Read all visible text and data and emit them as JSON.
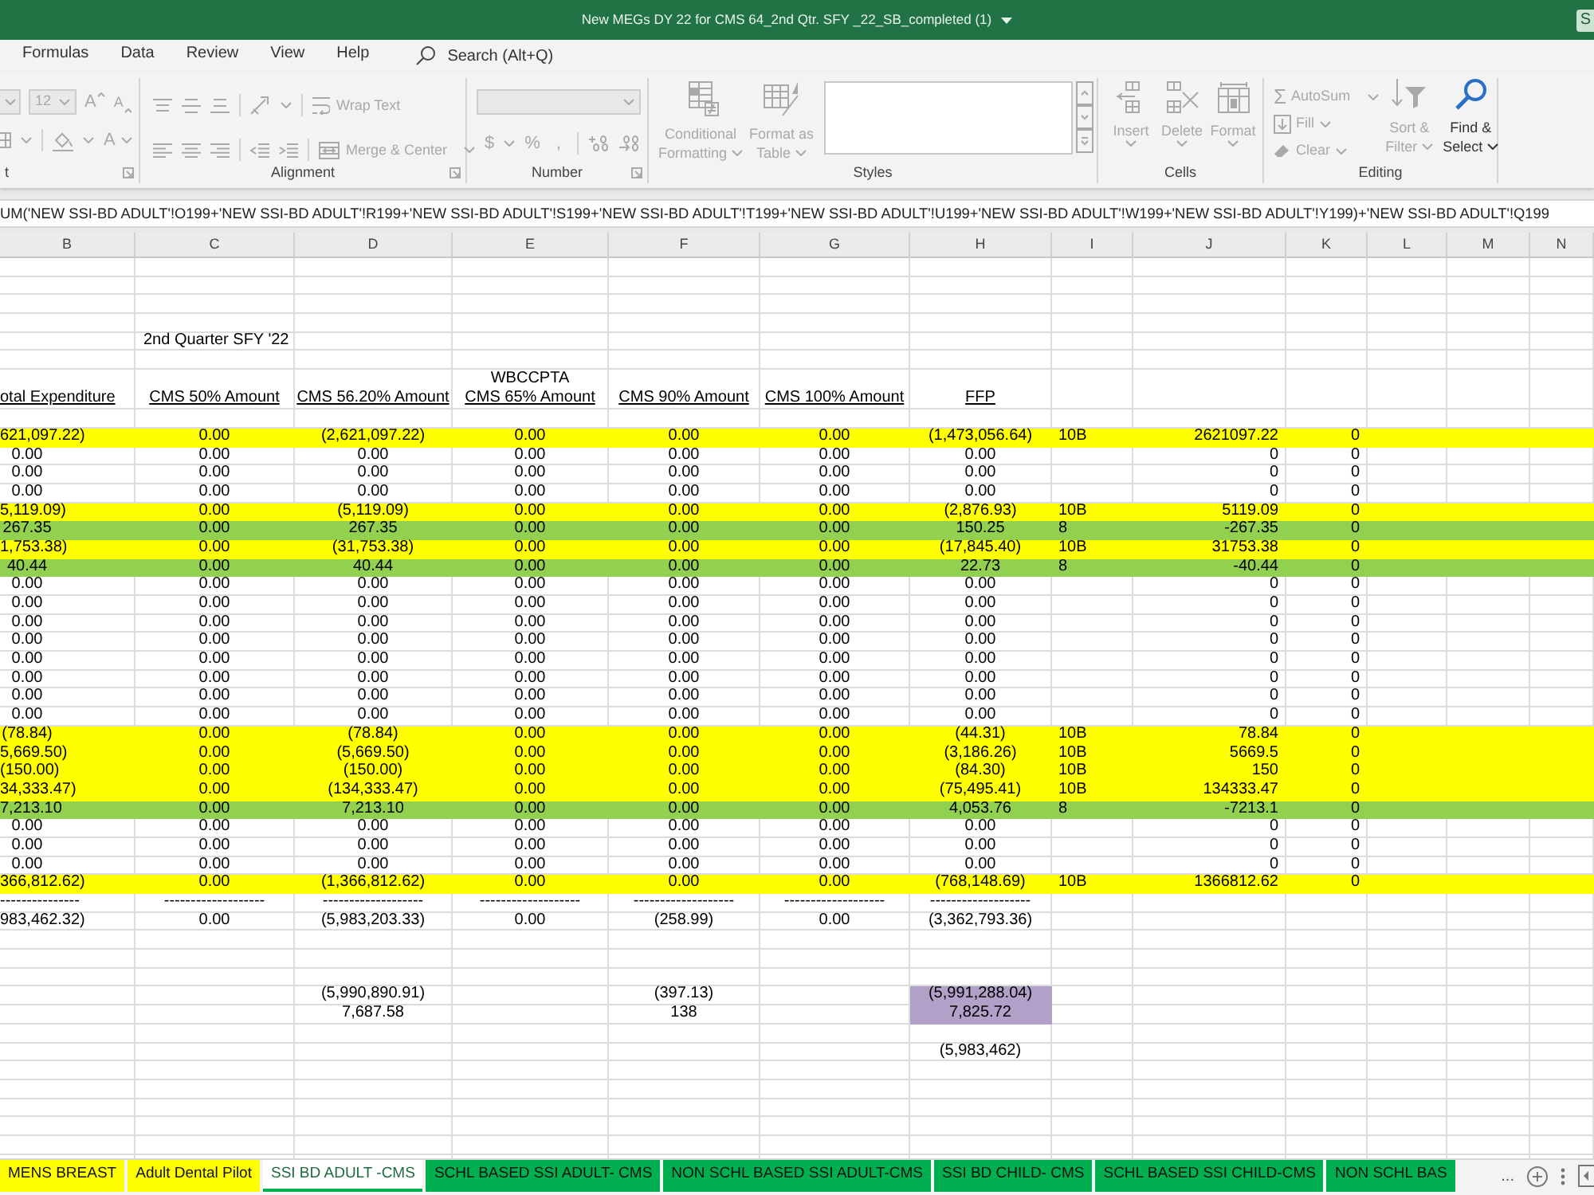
{
  "window": {
    "title": "New MEGs DY 22 for CMS 64_2nd Qtr. SFY _22_SB_completed (1)",
    "corner_button": "S"
  },
  "menu_tabs": [
    {
      "label": "Formulas",
      "selected": false
    },
    {
      "label": "Data",
      "selected": false
    },
    {
      "label": "Review",
      "selected": false
    },
    {
      "label": "View",
      "selected": false
    },
    {
      "label": "Help",
      "selected": false
    }
  ],
  "search": {
    "placeholder": "Search (Alt+Q)"
  },
  "ribbon": [
    {
      "kind": "font",
      "label": "t",
      "disabled": true,
      "font_size": "12",
      "grow": "A",
      "shrink": "A",
      "font_color": "A"
    },
    {
      "kind": "alignment",
      "label": "Alignment",
      "disabled": true,
      "wrap_text": "Wrap Text",
      "merge": "Merge & Center"
    },
    {
      "kind": "number",
      "label": "Number",
      "disabled": true,
      "currency": "$",
      "percent": "%",
      "comma": ","
    },
    {
      "kind": "styles",
      "label": "Styles",
      "disabled": true,
      "buttons": [
        [
          "Conditional",
          "Formatting"
        ],
        [
          "Format as",
          "Table"
        ]
      ]
    },
    {
      "kind": "cells",
      "label": "Cells",
      "disabled": true,
      "buttons": [
        "Insert",
        "Delete",
        "Format"
      ]
    },
    {
      "kind": "editing",
      "label": "Editing",
      "small": [
        {
          "kind": "autosum",
          "symbol": "Σ",
          "label": "AutoSum",
          "disabled": true
        },
        {
          "kind": "fill",
          "label": "Fill",
          "disabled": true
        },
        {
          "kind": "clear",
          "label": "Clear",
          "disabled": true
        }
      ],
      "large": [
        {
          "kind": "sort",
          "lines": [
            "Sort &",
            "Filter"
          ],
          "disabled": true
        },
        {
          "kind": "find",
          "lines": [
            "Find &",
            "Select"
          ],
          "disabled": false
        }
      ]
    }
  ],
  "formula_bar": {
    "formula": "UM('NEW SSI-BD ADULT'!O199+'NEW SSI-BD ADULT'!R199+'NEW SSI-BD ADULT'!S199+'NEW SSI-BD ADULT'!T199+'NEW SSI-BD ADULT'!U199+'NEW SSI-BD ADULT'!W199+'NEW SSI-BD ADULT'!Y199)+'NEW SSI-BD ADULT'!Q199"
  },
  "sheet": {
    "columns": [
      "B",
      "C",
      "D",
      "E",
      "F",
      "G",
      "H",
      "I",
      "J",
      "K",
      "L",
      "M",
      "N"
    ],
    "period": "2nd Quarter SFY '22",
    "headings": [
      {
        "text": "otal Expenditure"
      },
      {
        "text": "CMS 50% Amount"
      },
      {
        "text": "CMS 56.20% Amount"
      },
      {
        "caption": "WBCCPTA",
        "text": "CMS 65% Amount"
      },
      {
        "text": "CMS 90% Amount"
      },
      {
        "text": "CMS 100% Amount"
      },
      {
        "text": "FFP"
      }
    ],
    "rows": [
      {
        "color": "#ffff00",
        "amounts": [
          "621,097.22)",
          "0.00",
          "(2,621,097.22)",
          "0.00",
          "0.00",
          "0.00",
          "(1,473,056.64)"
        ],
        "column_i": "10B",
        "column_j": "2621097.22",
        "column_k": "0"
      },
      {
        "amounts": [
          "0.00",
          "0.00",
          "0.00",
          "0.00",
          "0.00",
          "0.00",
          "0.00"
        ],
        "column_j": "0",
        "column_k": "0"
      },
      {
        "amounts": [
          "0.00",
          "0.00",
          "0.00",
          "0.00",
          "0.00",
          "0.00",
          "0.00"
        ],
        "column_j": "0",
        "column_k": "0"
      },
      {
        "amounts": [
          "0.00",
          "0.00",
          "0.00",
          "0.00",
          "0.00",
          "0.00",
          "0.00"
        ],
        "column_j": "0",
        "column_k": "0"
      },
      {
        "color": "#ffff00",
        "amounts": [
          "5,119.09)",
          "0.00",
          "(5,119.09)",
          "0.00",
          "0.00",
          "0.00",
          "(2,876.93)"
        ],
        "column_i": "10B",
        "column_j": "5119.09",
        "column_k": "0"
      },
      {
        "color": "#92d050",
        "amounts": [
          "267.35",
          "0.00",
          "267.35",
          "0.00",
          "0.00",
          "0.00",
          "150.25"
        ],
        "column_i": "8",
        "column_j": "-267.35",
        "column_k": "0"
      },
      {
        "color": "#ffff00",
        "amounts": [
          "1,753.38)",
          "0.00",
          "(31,753.38)",
          "0.00",
          "0.00",
          "0.00",
          "(17,845.40)"
        ],
        "column_i": "10B",
        "column_j": "31753.38",
        "column_k": "0"
      },
      {
        "color": "#92d050",
        "amounts": [
          "40.44",
          "0.00",
          "40.44",
          "0.00",
          "0.00",
          "0.00",
          "22.73"
        ],
        "column_i": "8",
        "column_j": "-40.44",
        "column_k": "0"
      },
      {
        "amounts": [
          "0.00",
          "0.00",
          "0.00",
          "0.00",
          "0.00",
          "0.00",
          "0.00"
        ],
        "column_j": "0",
        "column_k": "0"
      },
      {
        "amounts": [
          "0.00",
          "0.00",
          "0.00",
          "0.00",
          "0.00",
          "0.00",
          "0.00"
        ],
        "column_j": "0",
        "column_k": "0"
      },
      {
        "amounts": [
          "0.00",
          "0.00",
          "0.00",
          "0.00",
          "0.00",
          "0.00",
          "0.00"
        ],
        "column_j": "0",
        "column_k": "0"
      },
      {
        "amounts": [
          "0.00",
          "0.00",
          "0.00",
          "0.00",
          "0.00",
          "0.00",
          "0.00"
        ],
        "column_j": "0",
        "column_k": "0"
      },
      {
        "amounts": [
          "0.00",
          "0.00",
          "0.00",
          "0.00",
          "0.00",
          "0.00",
          "0.00"
        ],
        "column_j": "0",
        "column_k": "0"
      },
      {
        "amounts": [
          "0.00",
          "0.00",
          "0.00",
          "0.00",
          "0.00",
          "0.00",
          "0.00"
        ],
        "column_j": "0",
        "column_k": "0"
      },
      {
        "amounts": [
          "0.00",
          "0.00",
          "0.00",
          "0.00",
          "0.00",
          "0.00",
          "0.00"
        ],
        "column_j": "0",
        "column_k": "0"
      },
      {
        "amounts": [
          "0.00",
          "0.00",
          "0.00",
          "0.00",
          "0.00",
          "0.00",
          "0.00"
        ],
        "column_j": "0",
        "column_k": "0"
      },
      {
        "color": "#ffff00",
        "amounts": [
          "(78.84)",
          "0.00",
          "(78.84)",
          "0.00",
          "0.00",
          "0.00",
          "(44.31)"
        ],
        "column_i": "10B",
        "column_j": "78.84",
        "column_k": "0"
      },
      {
        "color": "#ffff00",
        "amounts": [
          "5,669.50)",
          "0.00",
          "(5,669.50)",
          "0.00",
          "0.00",
          "0.00",
          "(3,186.26)"
        ],
        "column_i": "10B",
        "column_j": "5669.5",
        "column_k": "0"
      },
      {
        "color": "#ffff00",
        "amounts": [
          "(150.00)",
          "0.00",
          "(150.00)",
          "0.00",
          "0.00",
          "0.00",
          "(84.30)"
        ],
        "column_i": "10B",
        "column_j": "150",
        "column_k": "0"
      },
      {
        "color": "#ffff00",
        "amounts": [
          "34,333.47)",
          "0.00",
          "(134,333.47)",
          "0.00",
          "0.00",
          "0.00",
          "(75,495.41)"
        ],
        "column_i": "10B",
        "column_j": "134333.47",
        "column_k": "0"
      },
      {
        "color": "#92d050",
        "amounts": [
          "7,213.10",
          "0.00",
          "7,213.10",
          "0.00",
          "0.00",
          "0.00",
          "4,053.76"
        ],
        "column_i": "8",
        "column_j": "-7213.1",
        "column_k": "0"
      },
      {
        "amounts": [
          "0.00",
          "0.00",
          "0.00",
          "0.00",
          "0.00",
          "0.00",
          "0.00"
        ],
        "column_j": "0",
        "column_k": "0"
      },
      {
        "amounts": [
          "0.00",
          "0.00",
          "0.00",
          "0.00",
          "0.00",
          "0.00",
          "0.00"
        ],
        "column_j": "0",
        "column_k": "0"
      },
      {
        "amounts": [
          "0.00",
          "0.00",
          "0.00",
          "0.00",
          "0.00",
          "0.00",
          "0.00"
        ],
        "column_j": "0",
        "column_k": "0"
      },
      {
        "color": "#ffff00",
        "amounts": [
          "366,812.62)",
          "0.00",
          "(1,366,812.62)",
          "0.00",
          "0.00",
          "0.00",
          "(768,148.69)"
        ],
        "column_i": "10B",
        "column_j": "1366812.62",
        "column_k": "0"
      }
    ],
    "separator": [
      "---------------",
      "-------------------",
      "-------------------",
      "-------------------",
      "-------------------",
      "-------------------",
      "-------------------"
    ],
    "totals": [
      "983,462.32)",
      "0.00",
      "(5,983,203.33)",
      "0.00",
      "(258.99)",
      "0.00",
      "(3,362,793.36)"
    ],
    "reconciliation": [
      {
        "column_d": "(5,990,890.91)",
        "column_f": "(397.13)",
        "column_h": {
          "text": "(5,991,288.04)",
          "color": "#b1a0c7"
        }
      },
      {
        "column_d": "7,687.58",
        "column_f": "138",
        "column_h": {
          "text": "7,825.72",
          "color": "#b1a0c7"
        }
      }
    ],
    "result": {
      "column_h": "(5,983,462)"
    }
  },
  "sheet_tabs": [
    {
      "label": "MENS BREAST",
      "color": "#ffff00",
      "selected": false
    },
    {
      "label": "Adult Dental Pilot",
      "color": "#ffff00",
      "selected": false
    },
    {
      "label": "SSI BD ADULT -CMS",
      "color": "#00b050",
      "selected": true
    },
    {
      "label": "SCHL BASED SSI ADULT- CMS",
      "color": "#00b050",
      "selected": false
    },
    {
      "label": "NON SCHL BASED SSI ADULT-CMS",
      "color": "#00b050",
      "selected": false
    },
    {
      "label": "SSI BD CHILD- CMS",
      "color": "#00b050",
      "selected": false
    },
    {
      "label": "SCHL BASED SSI CHILD-CMS",
      "color": "#00b050",
      "selected": false
    },
    {
      "label": "NON SCHL BAS",
      "color": "#00b050",
      "selected": false
    }
  ],
  "tab_overflow": "..."
}
